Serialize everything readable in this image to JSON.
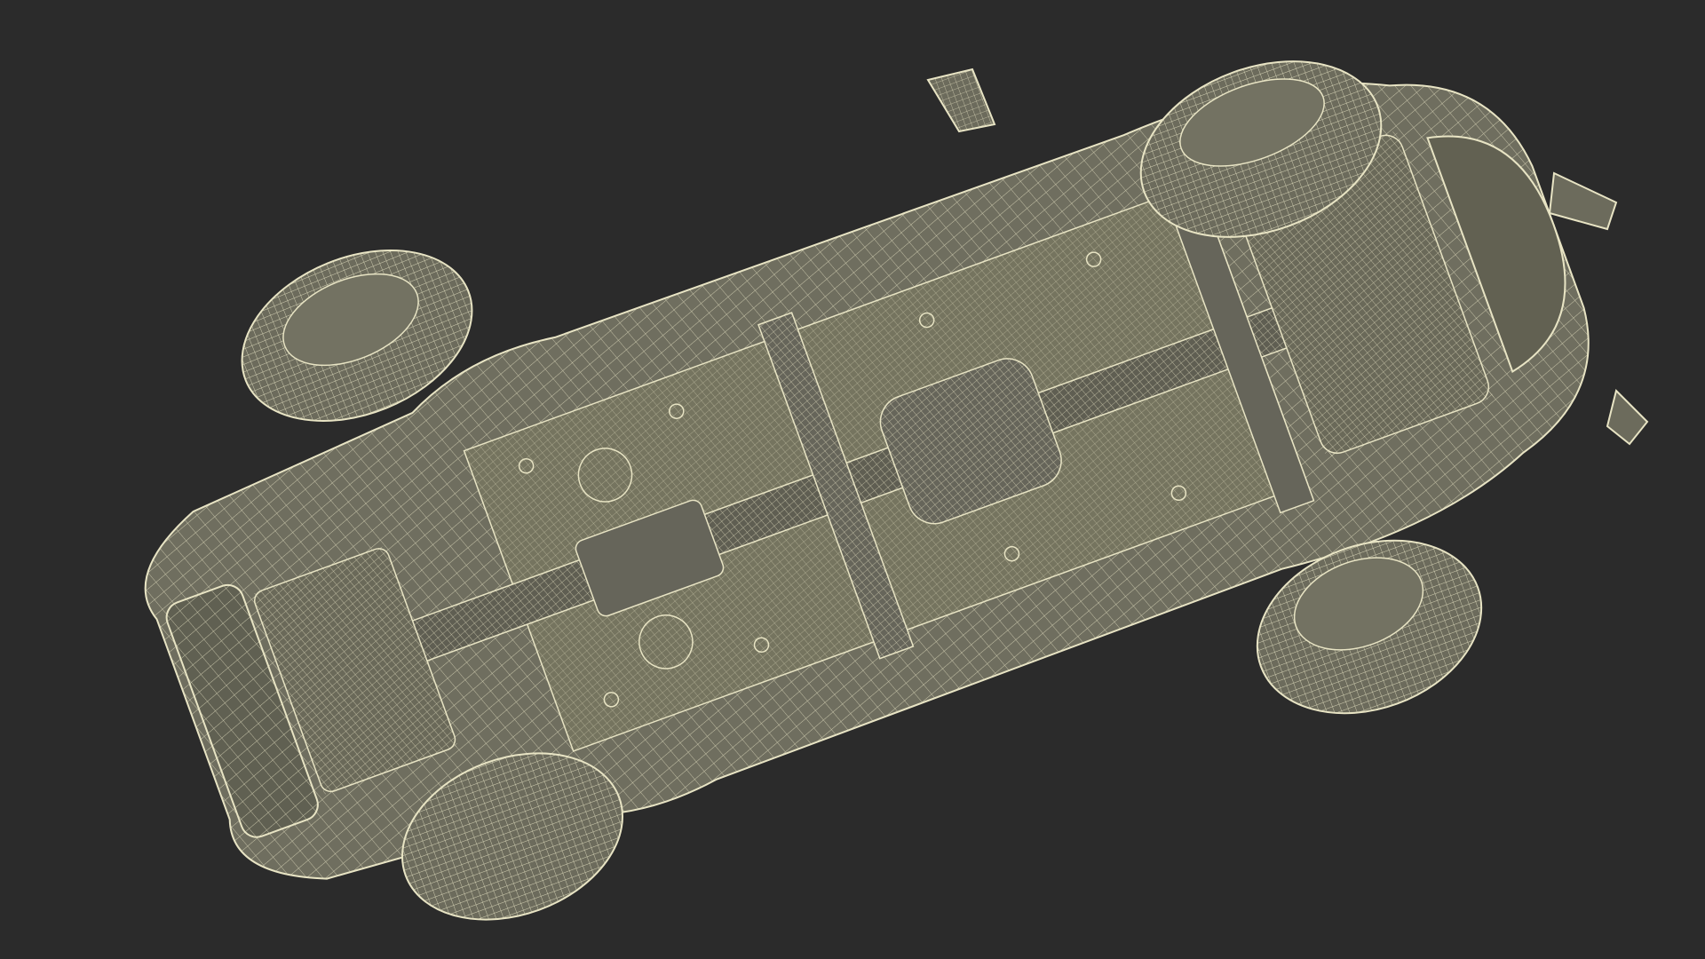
{
  "scene": {
    "background_color": "#2b2b2b",
    "model_fill": "#6f6e5f",
    "model_fill_light": "#858472",
    "model_fill_dark": "#55544a",
    "wire_color": "#e8e4c4",
    "subject": "wireframe-car-underside"
  }
}
